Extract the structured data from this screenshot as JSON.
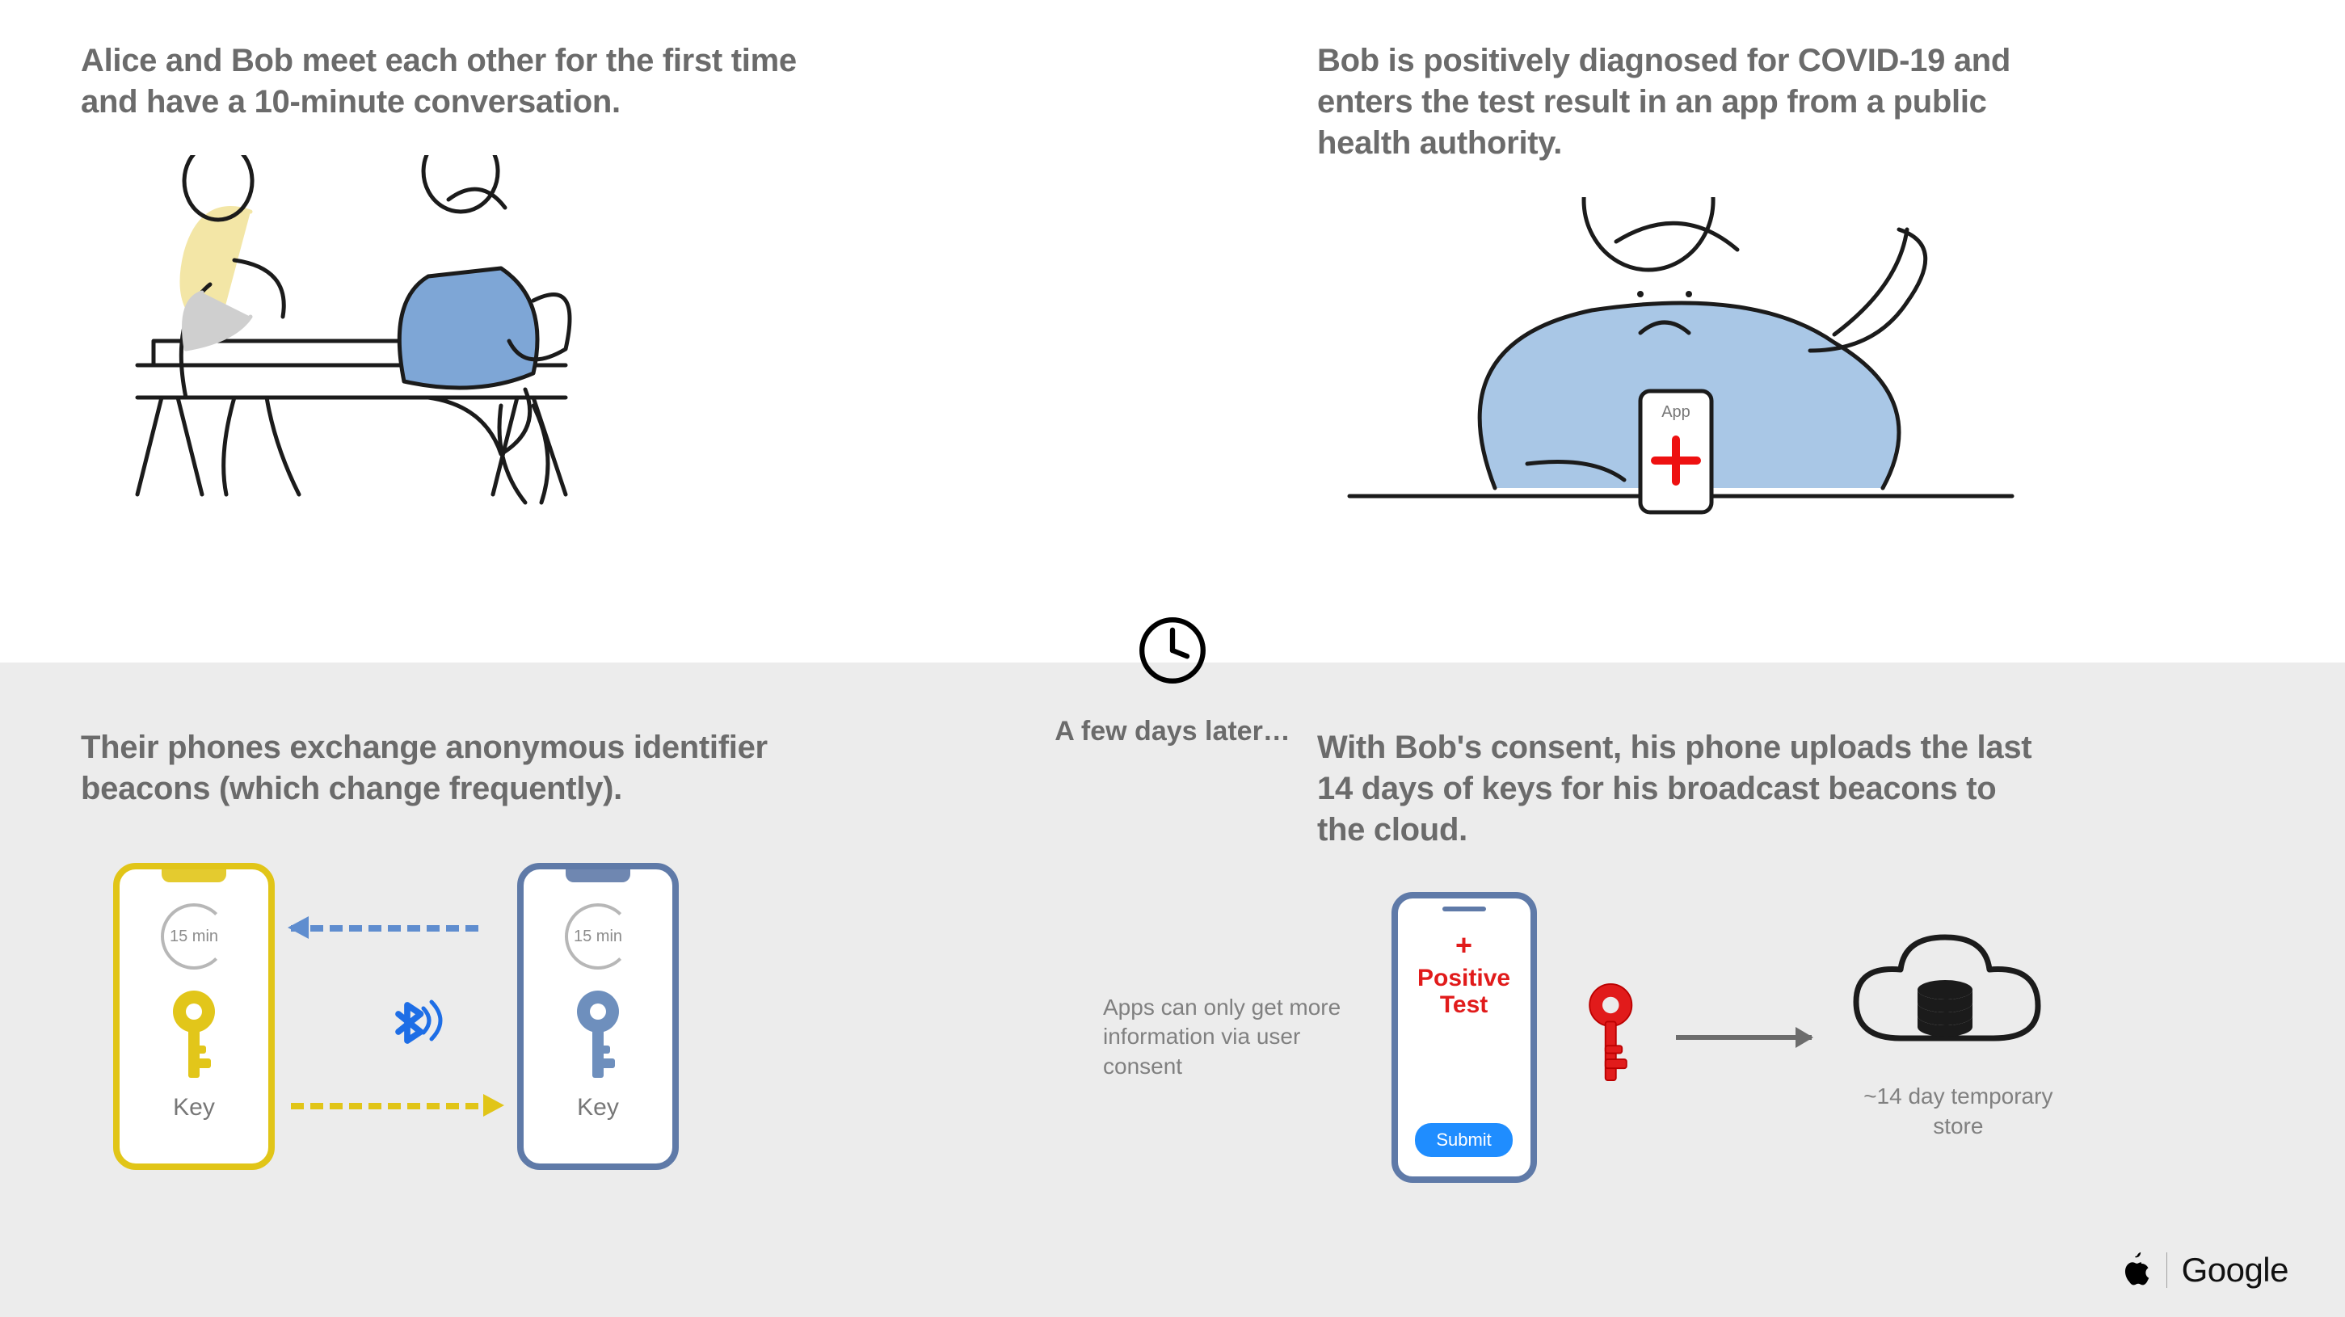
{
  "panels": {
    "p1": {
      "caption": "Alice and Bob meet each other for the first time and have a 10-minute conversation."
    },
    "p2": {
      "caption": "Bob is positively diagnosed for COVID-19 and enters the test result in an app from a public health authority.",
      "app_label": "App"
    },
    "p3": {
      "caption": "Their phones exchange anonymous identifier beacons (which change frequently).",
      "timer_text": "15 min",
      "key_label": "Key"
    },
    "p4": {
      "caption": "With Bob's consent, his phone uploads the last 14 days of keys for his broadcast beacons to the cloud.",
      "consent_note": "Apps can only get more information via user consent",
      "phone_title": "Positive Test",
      "plus": "+",
      "submit_label": "Submit",
      "cloud_label": "~14 day temporary store"
    }
  },
  "center": {
    "label": "A few days later…"
  },
  "footer": {
    "google": "Google"
  }
}
